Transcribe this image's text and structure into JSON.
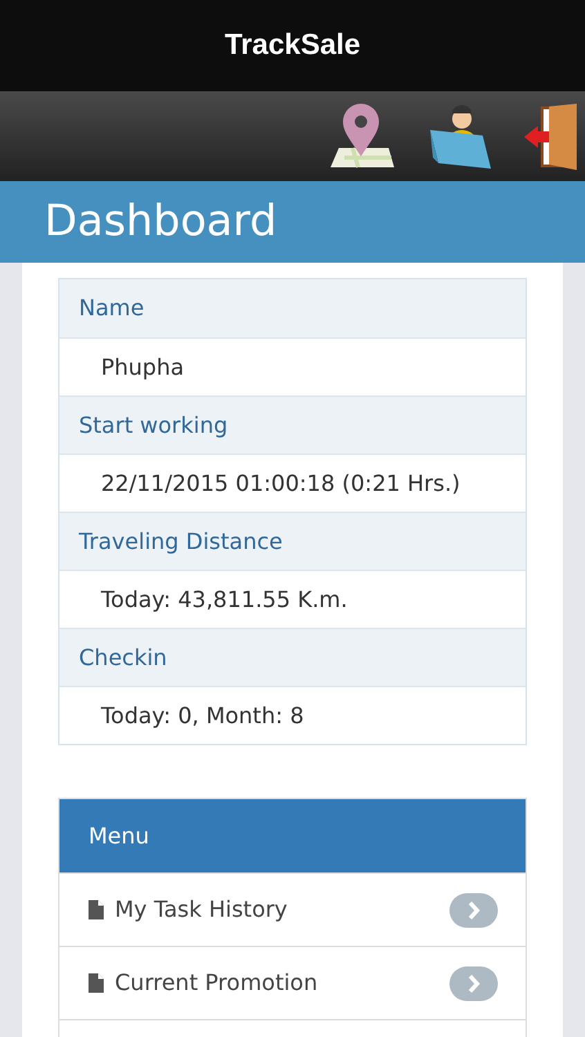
{
  "app_title": "TrackSale",
  "page_title": "Dashboard",
  "info": [
    {
      "label": "Name",
      "value": "Phupha"
    },
    {
      "label": "Start working",
      "value": "22/11/2015 01:00:18 (0:21 Hrs.)"
    },
    {
      "label": "Traveling Distance",
      "value": "Today: 43,811.55 K.m."
    },
    {
      "label": "Checkin",
      "value": "Today: 0, Month: 8"
    }
  ],
  "menu": {
    "title": "Menu",
    "items": [
      {
        "label": "My Task History"
      },
      {
        "label": "Current Promotion"
      }
    ]
  }
}
